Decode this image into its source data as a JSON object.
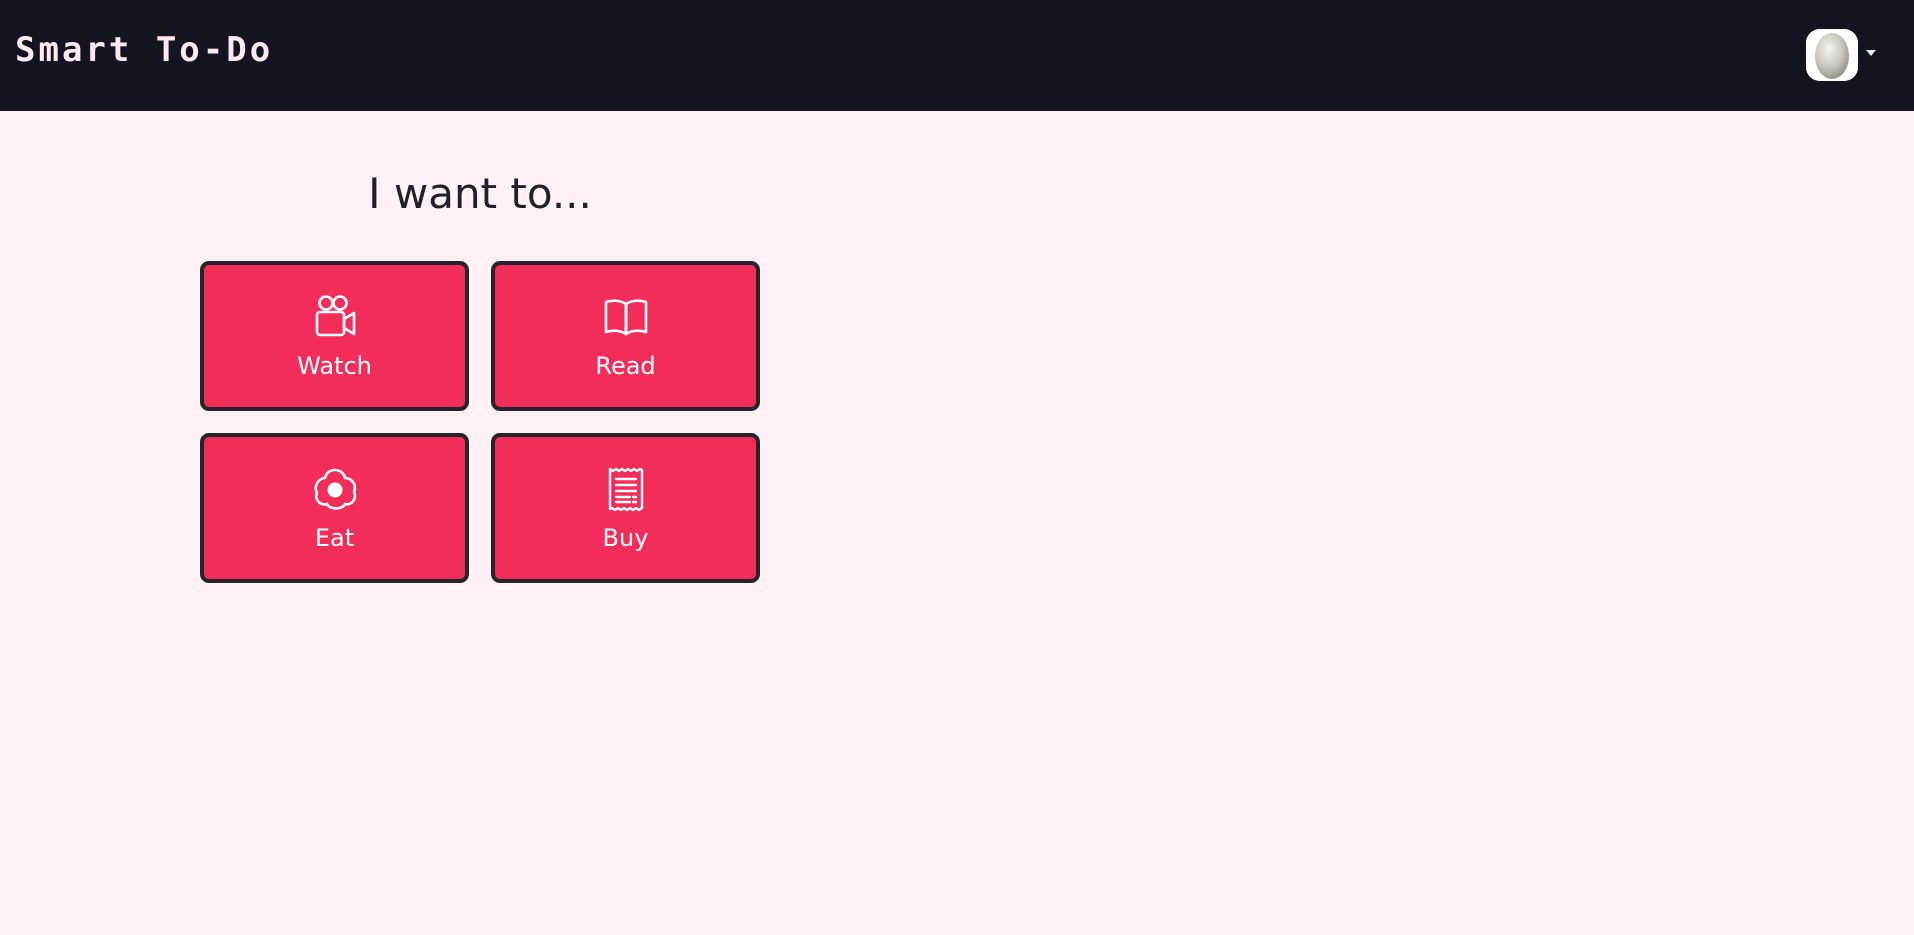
{
  "navbar": {
    "brand": "Smart To-Do",
    "user_menu": {
      "avatar_icon": "avatar-image",
      "caret_icon": "caret-down-icon"
    }
  },
  "main": {
    "heading": "I want to...",
    "categories": [
      {
        "label": "Watch",
        "icon": "camera-reels-icon"
      },
      {
        "label": "Read",
        "icon": "book-icon"
      },
      {
        "label": "Eat",
        "icon": "egg-fried-icon"
      },
      {
        "label": "Buy",
        "icon": "receipt-icon"
      }
    ]
  },
  "colors": {
    "navbar_bg": "#131520",
    "page_bg": "#fff1f5",
    "tile_bg": "#f22d5a",
    "tile_border": "#24252b",
    "heading_text": "#20222b",
    "tile_text": "#ffffff"
  }
}
